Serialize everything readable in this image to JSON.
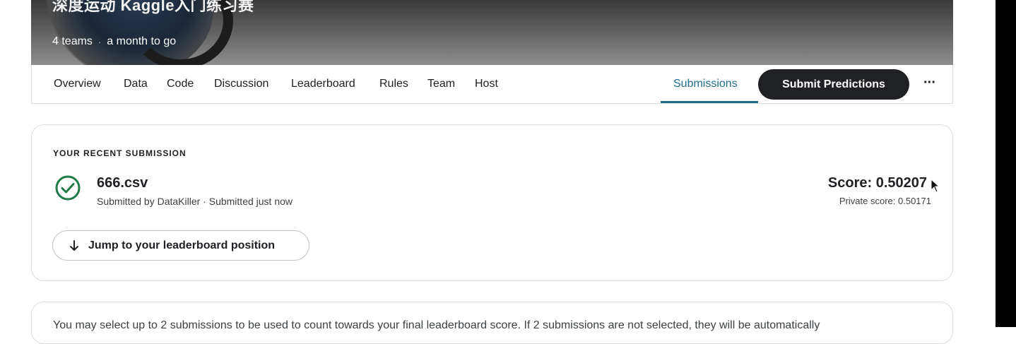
{
  "banner": {
    "title": "深度运动 Kaggle入门练习赛",
    "teams": "4 teams",
    "separator": "·",
    "time_left": "a month to go"
  },
  "nav": {
    "tabs": [
      "Overview",
      "Data",
      "Code",
      "Discussion",
      "Leaderboard",
      "Rules",
      "Team",
      "Host"
    ],
    "submissions": "Submissions",
    "submit_button": "Submit Predictions",
    "more": "···"
  },
  "recent_submission": {
    "heading": "YOUR RECENT SUBMISSION",
    "file_name": "666.csv",
    "meta": "Submitted by DataKiller · Submitted just now",
    "score": "Score: 0.50207",
    "private_score": "Private score: 0.50171",
    "jump_button": "Jump to your leaderboard position",
    "status_icon": "check-circle-icon"
  },
  "info": {
    "text": "You may select up to 2 submissions to be used to count towards your final leaderboard score. If 2 submissions are not selected, they will be automatically"
  },
  "colors": {
    "accent": "#1f6f8b",
    "success": "#1e7a46",
    "button_dark": "#202124"
  }
}
